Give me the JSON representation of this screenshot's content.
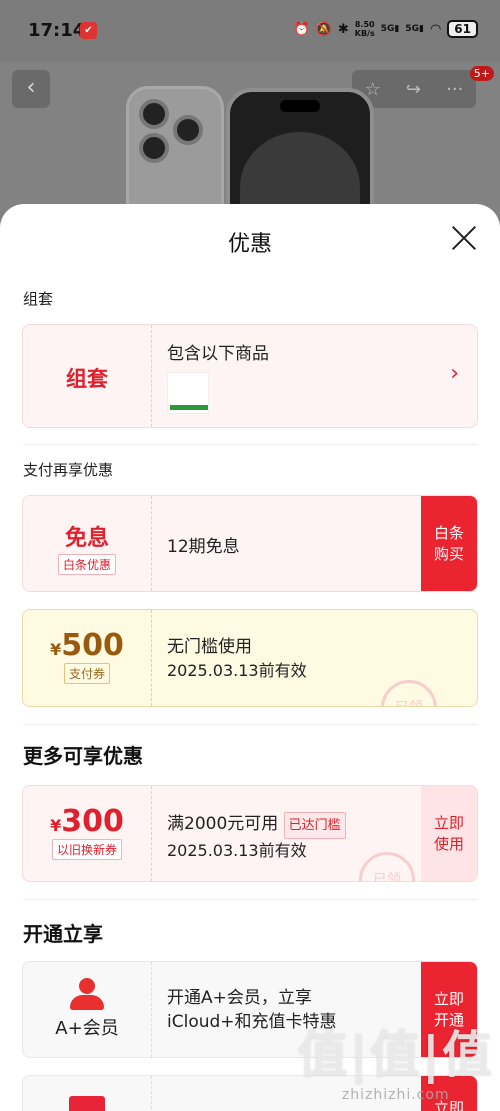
{
  "status_bar": {
    "time": "17:14",
    "net_speed_value": "8.50",
    "net_speed_unit": "KB/s",
    "sig1": "5G",
    "sig2": "5G",
    "battery": "61"
  },
  "hero": {
    "notification_count": "5+"
  },
  "sheet": {
    "title": "优惠",
    "bundle": {
      "section_label": "组套",
      "left_label": "组套",
      "desc": "包含以下商品",
      "arrow": "›"
    },
    "payment": {
      "section_label": "支付再享优惠",
      "interest_free": {
        "title": "免息",
        "tag": "白条优惠",
        "desc": "12期免息",
        "button": "白条\n购买"
      },
      "coupon": {
        "currency": "¥",
        "amount": "500",
        "tag": "支付券",
        "line1": "无门槛使用",
        "line2": "2025.03.13前有效",
        "stamp": "已领"
      }
    },
    "more": {
      "section_label": "更多可享优惠",
      "coupon": {
        "currency": "¥",
        "amount": "300",
        "tag": "以旧换新券",
        "line1": "满2000元可用",
        "badge": "已达门槛",
        "line2": "2025.03.13前有效",
        "button": "立即\n使用",
        "stamp": "已领"
      }
    },
    "open": {
      "section_label": "开通立享",
      "membership": {
        "label": "A+会员",
        "line1": "开通A+会员，立享",
        "line2": "iCloud+和充值卡特惠",
        "button": "立即\n开通"
      },
      "next_button": "立即"
    }
  },
  "watermark": {
    "big": "值|值|值",
    "small": "zhizhizhi.com"
  },
  "colors": {
    "accent_red": "#eb2431",
    "coupon_brown": "#9a5a0e",
    "coupon_yellow_bg": "#fffae2",
    "pink_bg": "#fff4f4"
  }
}
